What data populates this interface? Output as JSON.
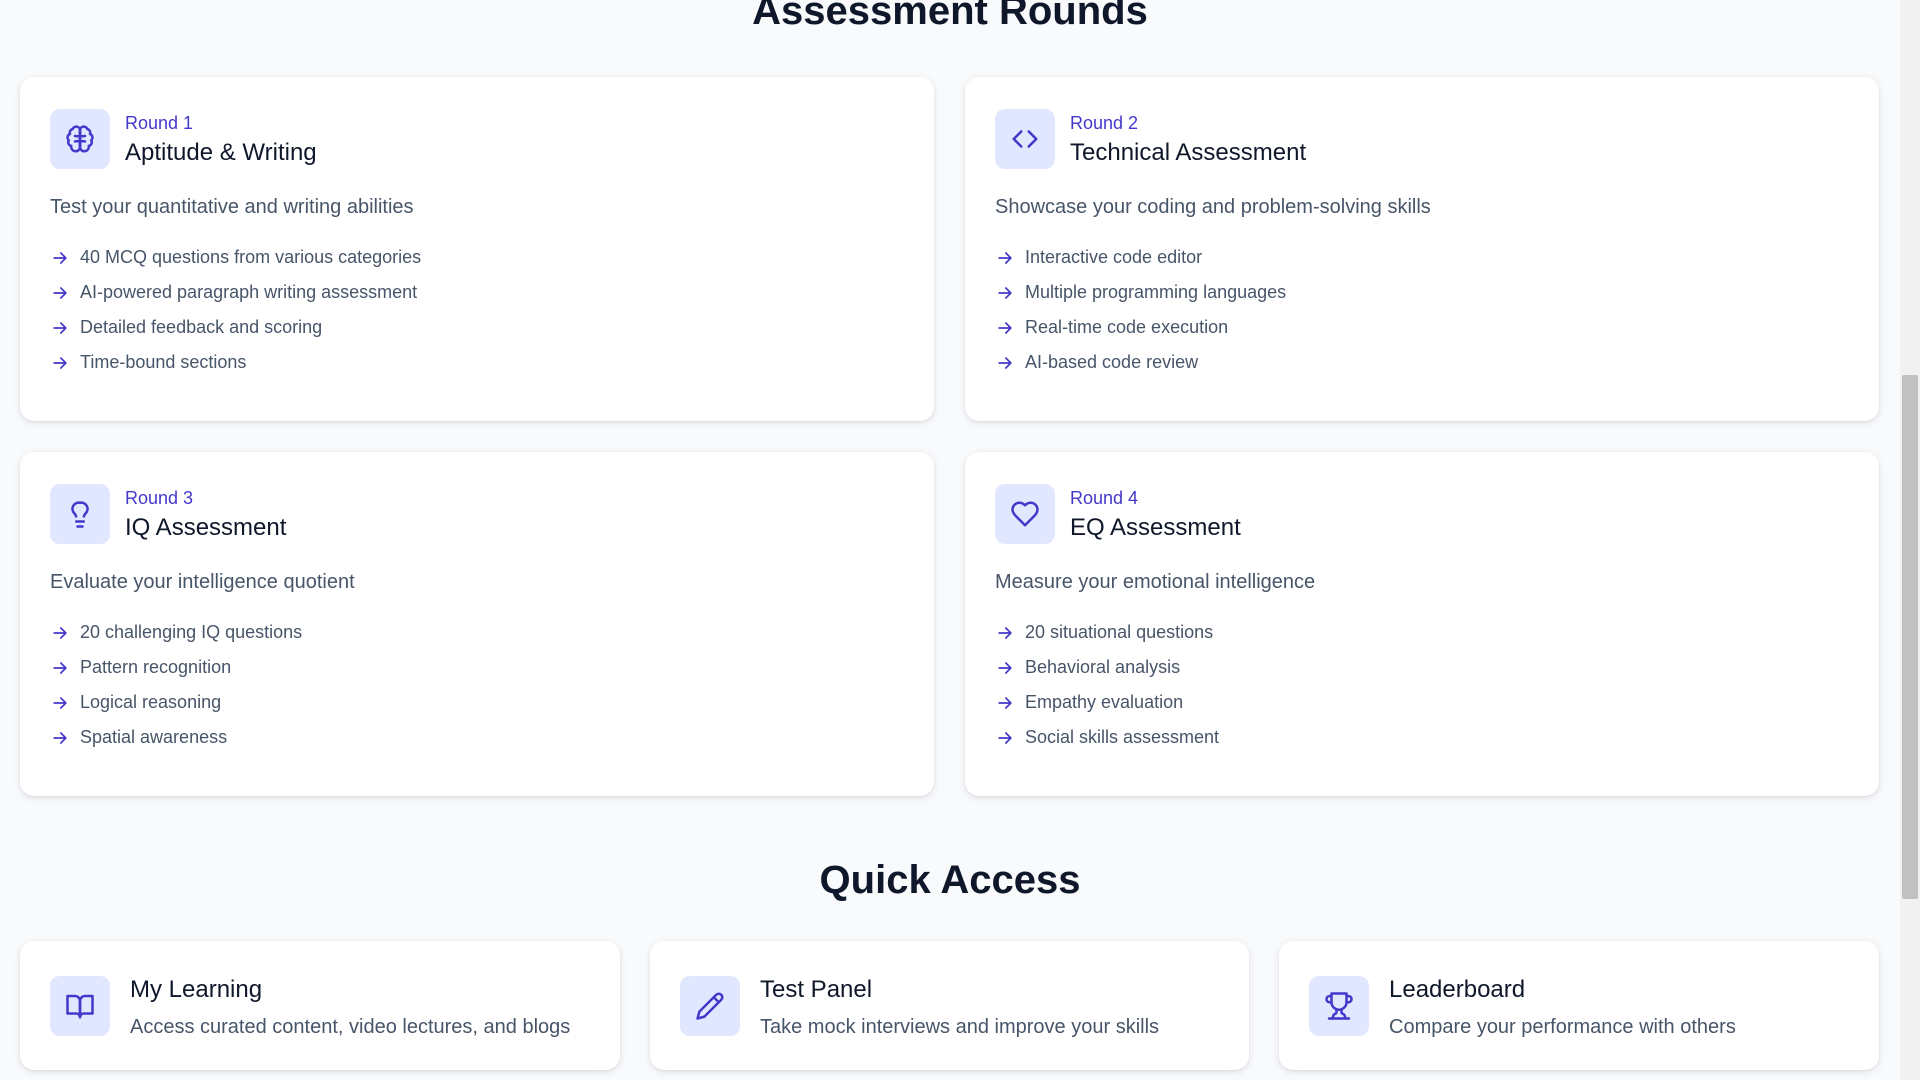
{
  "sections": {
    "rounds_title": "Assessment Rounds",
    "quick_title": "Quick Access"
  },
  "rounds": [
    {
      "label": "Round 1",
      "title": "Aptitude & Writing",
      "icon": "brain-icon",
      "description": "Test your quantitative and writing abilities",
      "features": [
        "40 MCQ questions from various categories",
        "AI-powered paragraph writing assessment",
        "Detailed feedback and scoring",
        "Time-bound sections"
      ]
    },
    {
      "label": "Round 2",
      "title": "Technical Assessment",
      "icon": "code-icon",
      "description": "Showcase your coding and problem-solving skills",
      "features": [
        "Interactive code editor",
        "Multiple programming languages",
        "Real-time code execution",
        "AI-based code review"
      ]
    },
    {
      "label": "Round 3",
      "title": "IQ Assessment",
      "icon": "lightbulb-icon",
      "description": "Evaluate your intelligence quotient",
      "features": [
        "20 challenging IQ questions",
        "Pattern recognition",
        "Logical reasoning",
        "Spatial awareness"
      ]
    },
    {
      "label": "Round 4",
      "title": "EQ Assessment",
      "icon": "heart-icon",
      "description": "Measure your emotional intelligence",
      "features": [
        "20 situational questions",
        "Behavioral analysis",
        "Empathy evaluation",
        "Social skills assessment"
      ]
    }
  ],
  "quick_access": [
    {
      "title": "My Learning",
      "icon": "book-icon",
      "description": "Access curated content, video lectures, and blogs"
    },
    {
      "title": "Test Panel",
      "icon": "pencil-icon",
      "description": "Take mock interviews and improve your skills"
    },
    {
      "title": "Leaderboard",
      "icon": "trophy-icon",
      "description": "Compare your performance with others"
    }
  ],
  "colors": {
    "accent": "#4338ca",
    "icon_bg": "#e0e7ff",
    "page_bg": "#f8fafc",
    "heading": "#0f172a",
    "body_text": "#475569"
  }
}
